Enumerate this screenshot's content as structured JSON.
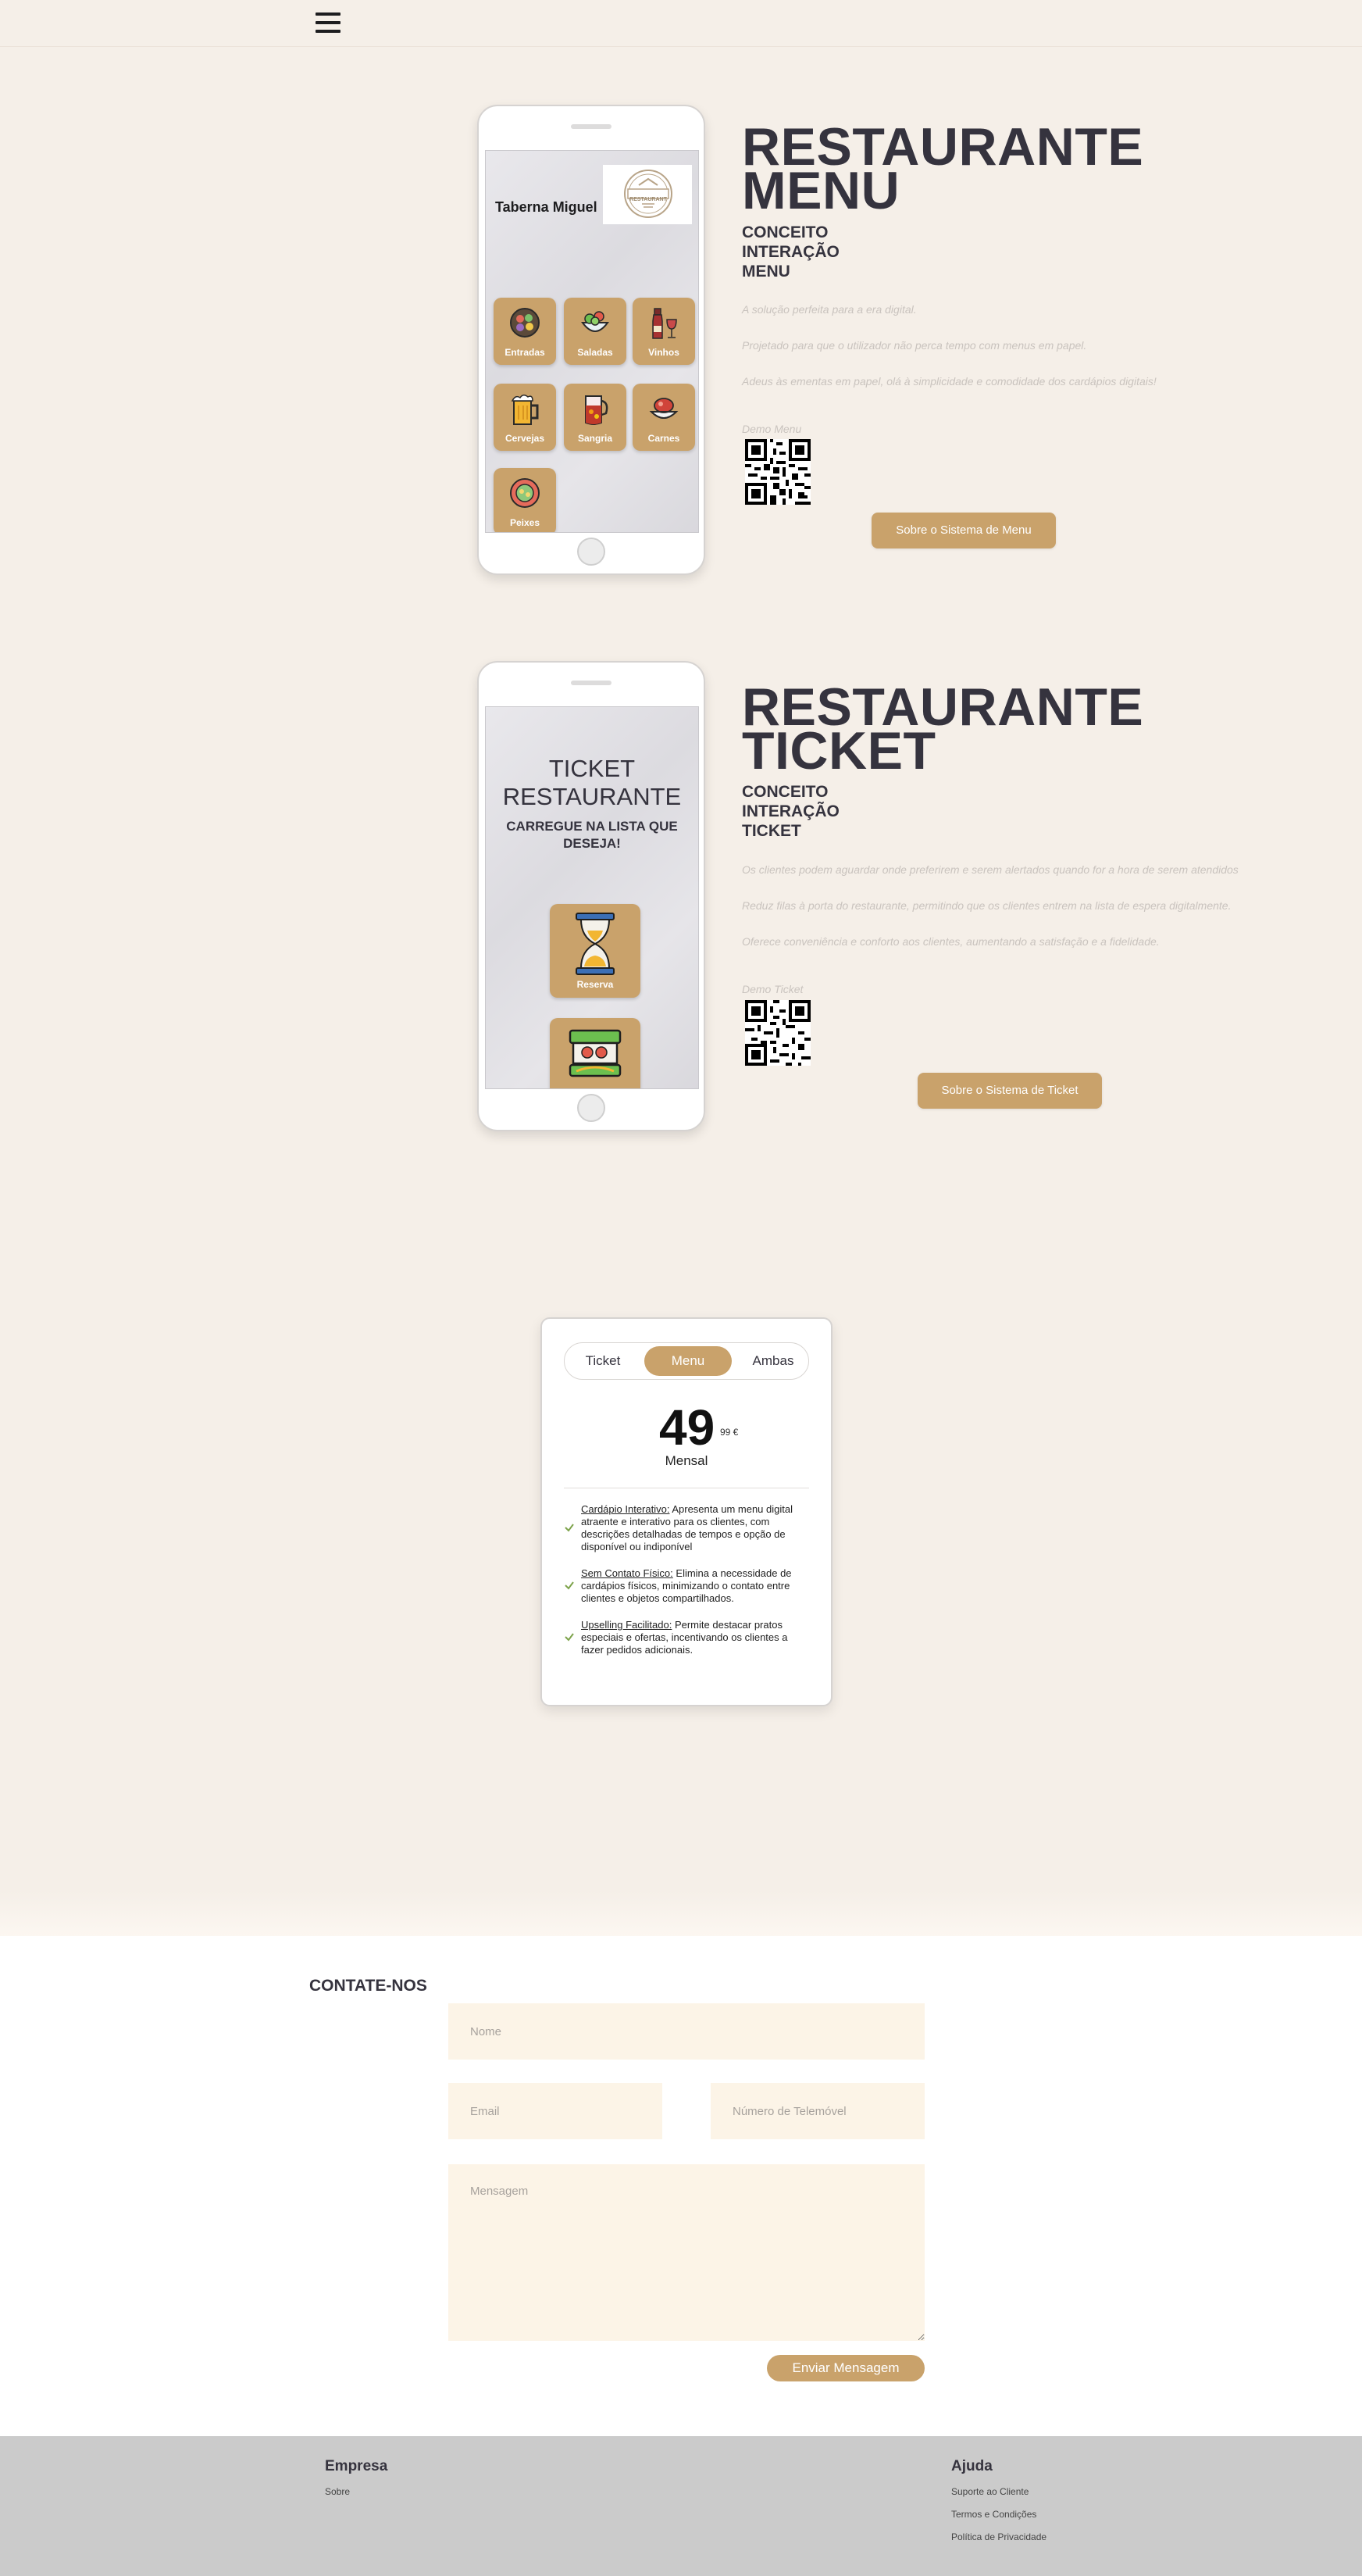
{
  "header": {
    "menu_icon": "hamburger-menu-icon"
  },
  "menu_section": {
    "phone": {
      "restaurant_name": "Taberna Miguel",
      "logo_text": "RESTAURANT",
      "categories": [
        {
          "label": "Entradas",
          "icon": "salad-bowl-icon"
        },
        {
          "label": "Saladas",
          "icon": "salad-icon"
        },
        {
          "label": "Vinhos",
          "icon": "wine-icon"
        },
        {
          "label": "Cervejas",
          "icon": "beer-mug-icon"
        },
        {
          "label": "Sangria",
          "icon": "sangria-pitcher-icon"
        },
        {
          "label": "Carnes",
          "icon": "meat-dish-icon"
        },
        {
          "label": "Peixes",
          "icon": "fish-plate-icon"
        }
      ]
    },
    "title_line1": "RESTAURANTE",
    "title_line2": "MENU",
    "subtitle_lines": [
      "CONCEITO",
      "INTERAÇÃO",
      "MENU"
    ],
    "descriptions": [
      "A solução perfeita para a era digital.",
      "Projetado para que o utilizador não perca tempo com menus em papel.",
      "Adeus às ementas em papel, olá à simplicidade e comodidade dos cardápios digitais!"
    ],
    "demo_label": "Demo Menu",
    "button": "Sobre o Sistema de Menu"
  },
  "ticket_section": {
    "phone": {
      "title_lines": [
        "TICKET",
        "RESTAURANTE"
      ],
      "subtitle_lines": [
        "CARREGUE NA LISTA QUE",
        "DESEJA!"
      ],
      "tile_label": "Reserva"
    },
    "title_line1": "RESTAURANTE",
    "title_line2": "TICKET",
    "subtitle_lines": [
      "CONCEITO",
      "INTERAÇÃO",
      "TICKET"
    ],
    "descriptions": [
      "Os clientes podem aguardar onde preferirem e serem alertados quando for a hora de serem atendidos",
      "Reduz filas à porta do restaurante, permitindo que os clientes entrem na lista de espera digitalmente.",
      "Oferece conveniência e conforto aos clientes, aumentando a satisfação e a fidelidade."
    ],
    "demo_label": "Demo Ticket",
    "button": "Sobre o Sistema de Ticket"
  },
  "pricing": {
    "options": [
      "Ticket",
      "Menu",
      "Ambas"
    ],
    "selected": "Menu",
    "price": "49",
    "cents": "99 €",
    "period": "Mensal",
    "features": [
      {
        "title": "Cardápio Interativo:",
        "text": " Apresenta um menu digital atraente e interativo para os clientes, com descrições detalhadas de tempos e opção de disponível ou indiponível"
      },
      {
        "title": "Sem Contato Físico:",
        "text": " Elimina a necessidade de cardápios físicos, minimizando o contato entre clientes e objetos compartilhados."
      },
      {
        "title": "Upselling Facilitado:",
        "text": " Permite destacar pratos especiais e ofertas, incentivando os clientes a fazer pedidos adicionais."
      }
    ]
  },
  "contact": {
    "title": "CONTATE-NOS",
    "name_placeholder": "Nome",
    "email_placeholder": "Email",
    "phone_placeholder": "Número de Telemóvel",
    "message_placeholder": "Mensagem",
    "submit": "Enviar Mensagem"
  },
  "footer": {
    "col1": {
      "heading": "Empresa",
      "links": [
        "Sobre"
      ]
    },
    "col2": {
      "heading": "Ajuda",
      "links": [
        "Suporte ao Cliente",
        "Termos e Condições",
        "Política de Privacidade"
      ]
    }
  },
  "colors": {
    "background": "#f5efe8",
    "accent": "#c9a26b",
    "text": "#35333e",
    "field_bg": "#fcf4e7",
    "footer": "#cbcbcb"
  }
}
